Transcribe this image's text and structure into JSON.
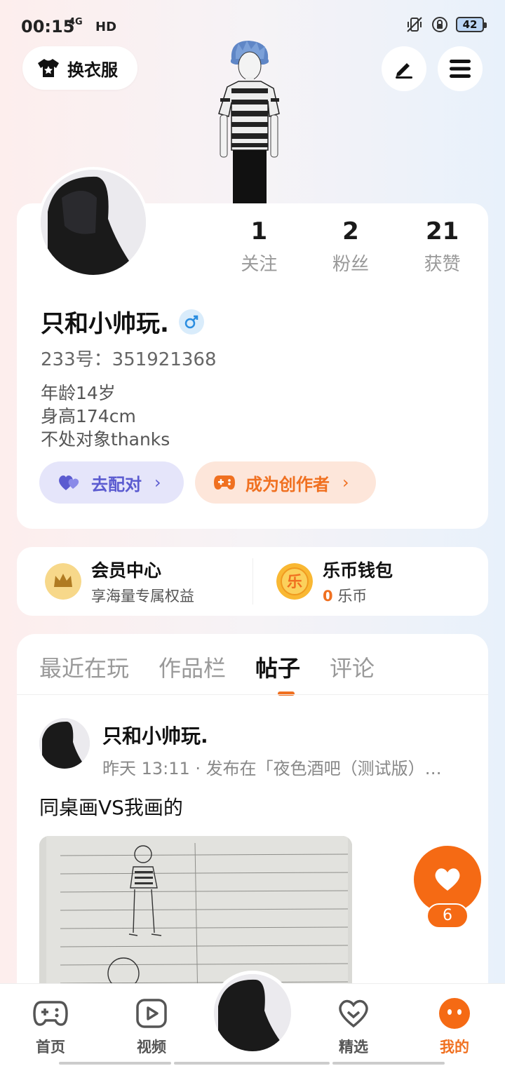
{
  "status_bar": {
    "time": "00:15",
    "network": "4G",
    "hd": "HD",
    "battery": "42"
  },
  "header": {
    "change_outfit_label": "换衣服"
  },
  "profile": {
    "stats": [
      {
        "value": "1",
        "label": "关注"
      },
      {
        "value": "2",
        "label": "粉丝"
      },
      {
        "value": "21",
        "label": "获赞"
      }
    ],
    "username": "只和小帅玩.",
    "uid": "233号：351921368",
    "bio_lines": [
      "年龄14岁",
      "身高174cm",
      "不处对象thanks"
    ],
    "match_button": "去配对",
    "creator_button": "成为创作者"
  },
  "wallet": {
    "vip_title": "会员中心",
    "vip_sub": "享海量专属权益",
    "coin_title": "乐币钱包",
    "coin_amount": "0",
    "coin_unit": "乐币",
    "coin_glyph": "乐"
  },
  "tabs": [
    "最近在玩",
    "作品栏",
    "帖子",
    "评论"
  ],
  "post": {
    "author": "只和小帅玩.",
    "meta": "昨天 13:11 · 发布在「夜色酒吧（测试版）…",
    "title": "同桌画VS我画的",
    "like_count": "6"
  },
  "bottom_nav": [
    {
      "label": "首页",
      "icon": "gamepad-icon"
    },
    {
      "label": "视频",
      "icon": "play-icon"
    },
    {
      "label": "精选",
      "icon": "heart-outline-icon"
    },
    {
      "label": "我的",
      "icon": "face-icon"
    }
  ],
  "colors": {
    "accent": "#f07020",
    "match": "#5b5bd0"
  }
}
